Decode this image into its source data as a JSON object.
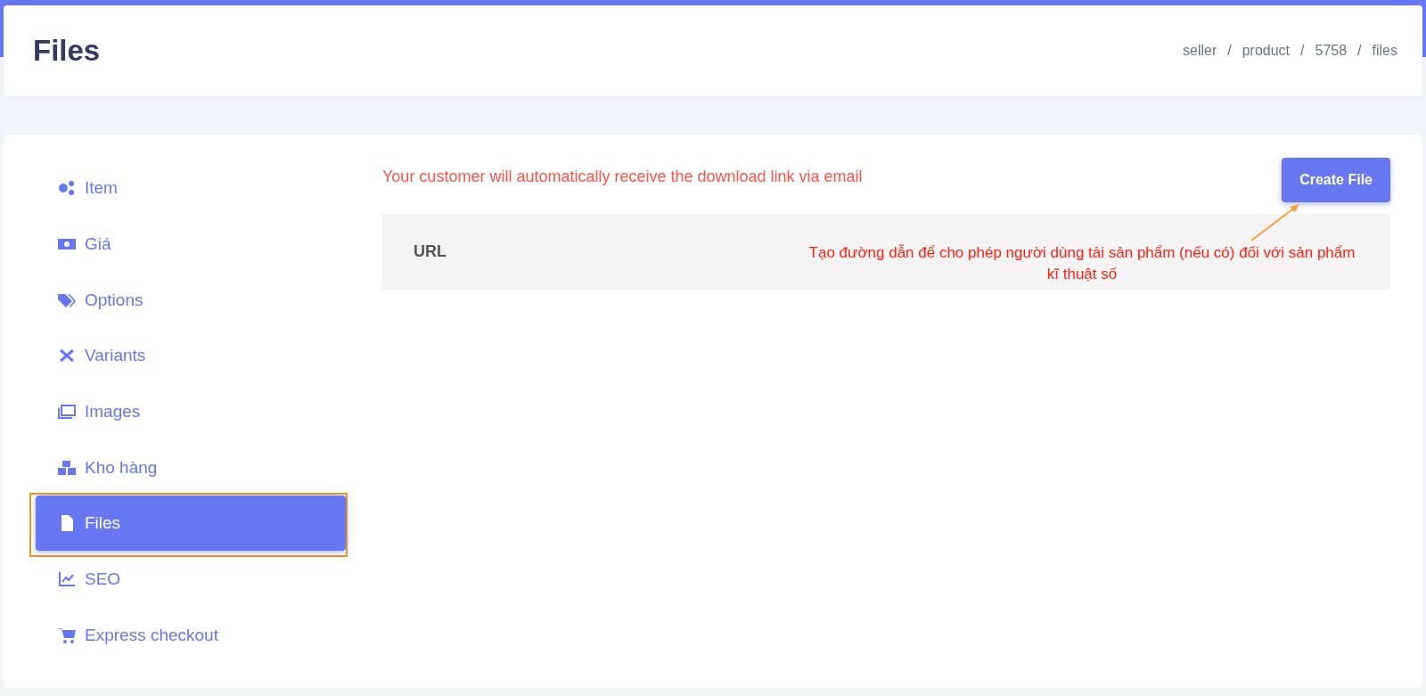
{
  "header": {
    "title": "Files",
    "breadcrumb": [
      "seller",
      "product",
      "5758",
      "files"
    ],
    "separator": "/"
  },
  "sidebar": {
    "items": [
      {
        "label": "Item",
        "selected": false
      },
      {
        "label": "Giá",
        "selected": false
      },
      {
        "label": "Options",
        "selected": false
      },
      {
        "label": "Variants",
        "selected": false
      },
      {
        "label": "Images",
        "selected": false
      },
      {
        "label": "Kho hàng",
        "selected": false
      },
      {
        "label": "Files",
        "selected": true
      },
      {
        "label": "SEO",
        "selected": false
      },
      {
        "label": "Express checkout",
        "selected": false
      }
    ]
  },
  "content": {
    "notice": "Your customer will automatically receive the download link via email",
    "create_button": "Create File",
    "table": {
      "columns": [
        "URL"
      ]
    }
  },
  "annotation": {
    "note": "Tạo đường dẫn để cho phép người dùng tải sản phẩm (nếu có) đối với sản phẩm kĩ thuật số"
  }
}
